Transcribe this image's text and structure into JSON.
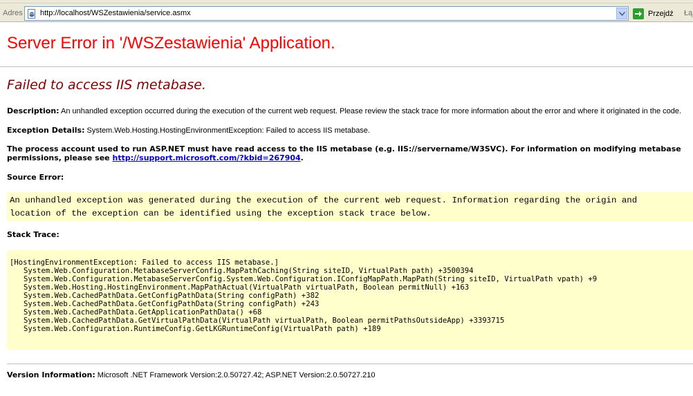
{
  "address_bar": {
    "label": "Adres",
    "url": "http://localhost/WSZestawienia/service.asmx",
    "go_label": "Przejdź",
    "links_label": "Łą"
  },
  "page": {
    "title": "Server Error in '/WSZestawienia' Application.",
    "error_heading": "Failed to access IIS metabase.",
    "description_label": "Description:",
    "description_text": "An unhandled exception occurred during the execution of the current web request. Please review the stack trace for more information about the error and where it originated in the code.",
    "exception_label": "Exception Details:",
    "exception_text": "System.Web.Hosting.HostingEnvironmentException: Failed to access IIS metabase.",
    "process_text": "The process account used to run ASP.NET must have read access to the IIS metabase (e.g. IIS://servername/W3SVC). For information on modifying metabase permissions, please see",
    "process_link": "http://support.microsoft.com/?kbid=267904",
    "process_end": ".",
    "source_error_label": "Source Error:",
    "source_error_lines": [
      "An unhandled exception was generated during the execution of the current web request. Information regarding the origin and",
      "location of the exception can be identified using the exception stack trace below."
    ],
    "stack_trace_label": "Stack Trace:",
    "stack_header": "[HostingEnvironmentException: Failed to access IIS metabase.]",
    "stack_lines": [
      "System.Web.Configuration.MetabaseServerConfig.MapPathCaching(String siteID, VirtualPath path) +3500394",
      "System.Web.Configuration.MetabaseServerConfig.System.Web.Configuration.IConfigMapPath.MapPath(String siteID, VirtualPath vpath) +9",
      "System.Web.Hosting.HostingEnvironment.MapPathActual(VirtualPath virtualPath, Boolean permitNull) +163",
      "System.Web.CachedPathData.GetConfigPathData(String configPath) +382",
      "System.Web.CachedPathData.GetConfigPathData(String configPath) +243",
      "System.Web.CachedPathData.GetApplicationPathData() +68",
      "System.Web.CachedPathData.GetVirtualPathData(VirtualPath virtualPath, Boolean permitPathsOutsideApp) +3393715",
      "System.Web.Configuration.RuntimeConfig.GetLKGRuntimeConfig(VirtualPath path) +189"
    ],
    "version_label": "Version Information:",
    "version_text": "Microsoft .NET Framework Version:2.0.50727.42; ASP.NET Version:2.0.50727.210"
  },
  "colors": {
    "title": "#ff0000",
    "error_heading": "#800000",
    "code_background": "#ffffcc",
    "link": "#0000cc"
  },
  "icons": {
    "page": "ie-page-icon",
    "dropdown": "chevron-down-icon",
    "go": "green-arrow-icon"
  }
}
